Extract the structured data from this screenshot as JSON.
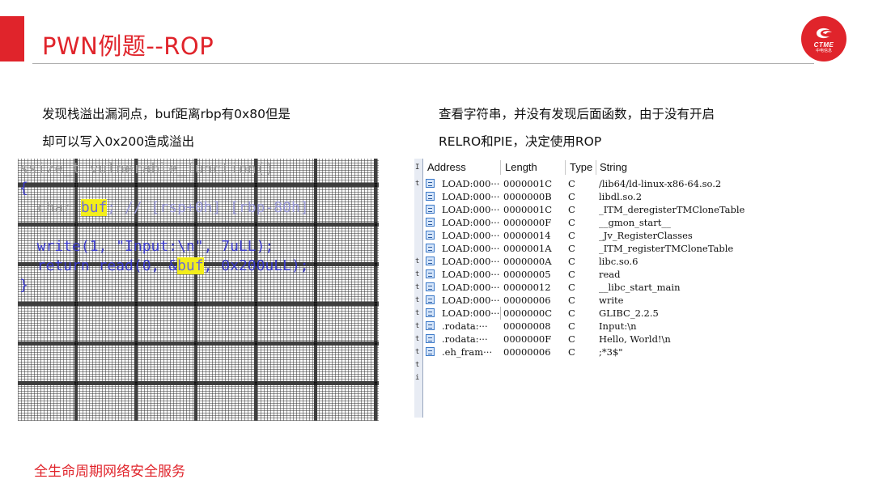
{
  "slide": {
    "title": "PWN例题--ROP",
    "footer": "全生命周期网络安全服务",
    "accent_color": "#e0242b"
  },
  "logo": {
    "brand": "CTME",
    "sub": "中电信息"
  },
  "left_text": {
    "line1": "发现栈溢出漏洞点，buf距离rbp有0x80但是",
    "line2": "却可以写入0x200造成溢出"
  },
  "right_text": {
    "line1": "查看字符串，并没有发现后面函数，由于没有开启",
    "line2": "RELRO和PIE，决定使用ROP"
  },
  "code": {
    "line1": "ssize_t vulnerable_function()",
    "line2": "{",
    "line3_prefix": "  char ",
    "line3_hl": "buf",
    "line3_suffix": "; // [rsp+0h] [rbp-80h]",
    "line5": "  write(1, \"Input:\\n\", 7uLL);",
    "line6_prefix": "  return read(0, &",
    "line6_hl": "buf",
    "line6_suffix": ", 0x200uLL);",
    "line7": "}"
  },
  "strings_window": {
    "headers": {
      "address": "Address",
      "length": "Length",
      "type": "Type",
      "string": "String"
    },
    "rows": [
      {
        "address": "LOAD:000···",
        "length": "0000001C",
        "type": "C",
        "string": "/lib64/ld-linux-x86-64.so.2"
      },
      {
        "address": "LOAD:000···",
        "length": "0000000B",
        "type": "C",
        "string": "libdl.so.2"
      },
      {
        "address": "LOAD:000···",
        "length": "0000001C",
        "type": "C",
        "string": "_ITM_deregisterTMCloneTable"
      },
      {
        "address": "LOAD:000···",
        "length": "0000000F",
        "type": "C",
        "string": "__gmon_start__"
      },
      {
        "address": "LOAD:000···",
        "length": "00000014",
        "type": "C",
        "string": "_Jv_RegisterClasses"
      },
      {
        "address": "LOAD:000···",
        "length": "0000001A",
        "type": "C",
        "string": "_ITM_registerTMCloneTable"
      },
      {
        "address": "LOAD:000···",
        "length": "0000000A",
        "type": "C",
        "string": "libc.so.6"
      },
      {
        "address": "LOAD:000···",
        "length": "00000005",
        "type": "C",
        "string": "read"
      },
      {
        "address": "LOAD:000···",
        "length": "00000012",
        "type": "C",
        "string": "__libc_start_main"
      },
      {
        "address": "LOAD:000···",
        "length": "00000006",
        "type": "C",
        "string": "write"
      },
      {
        "address": "LOAD:000···",
        "length": "0000000C",
        "type": "C",
        "string": "GLIBC_2.2.5"
      },
      {
        "address": ".rodata:···",
        "length": "00000008",
        "type": "C",
        "string": "Input:\\n"
      },
      {
        "address": ".rodata:···",
        "length": "0000000F",
        "type": "C",
        "string": "Hello, World!\\n"
      },
      {
        "address": ".eh_fram···",
        "length": "00000006",
        "type": "C",
        "string": ";*3$\""
      }
    ]
  }
}
